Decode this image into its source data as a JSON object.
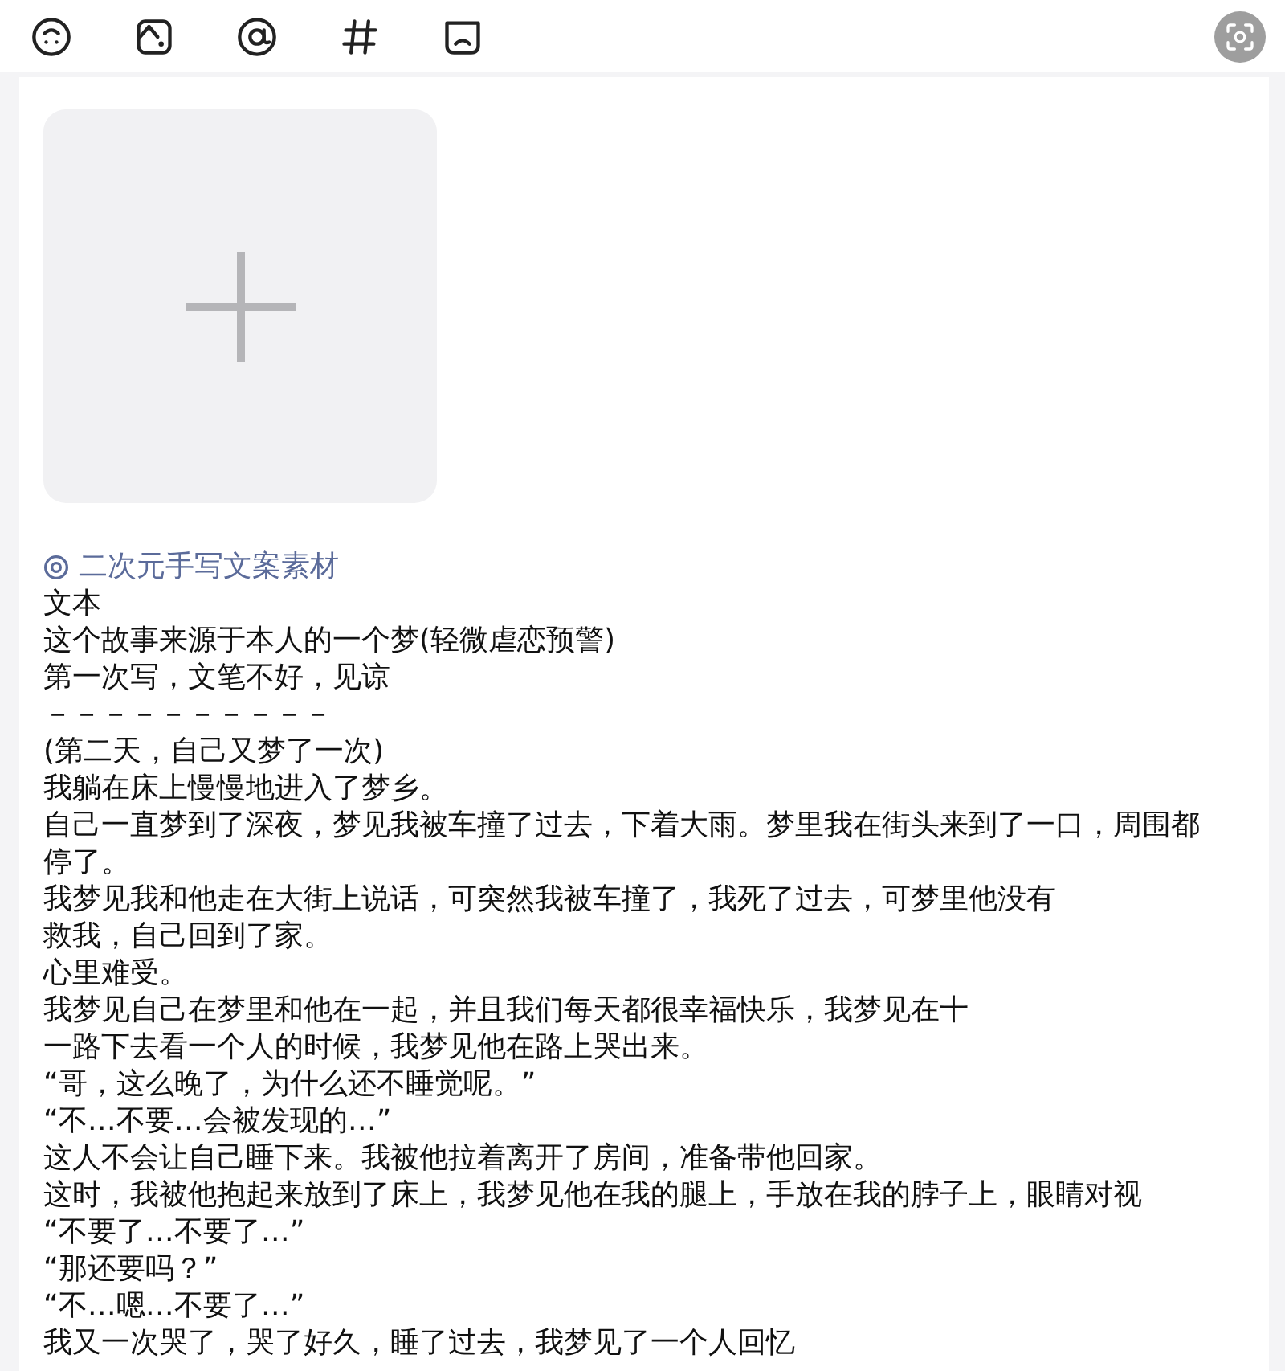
{
  "toolbar": {
    "tools": [
      {
        "kind": "emoji"
      },
      {
        "kind": "image"
      },
      {
        "kind": "mention"
      },
      {
        "kind": "topic"
      },
      {
        "kind": "box"
      }
    ]
  },
  "editor": {
    "image_slot": {
      "kind": "add"
    },
    "topic_link": "二次元手写文案素材",
    "lines": [
      "文本",
      "这个故事来源于本人的一个梦(轻微虐恋预警)",
      "第一次写，文笔不好，见谅",
      "－－－－－－－－－－",
      "(第二天，自己又梦了一次)",
      "我躺在床上慢慢地进入了梦乡。",
      "自己一直梦到了深夜，梦见我被车撞了过去，下着大雨。梦里我在街头来到了一口，周围都",
      "停了。",
      "我梦见我和他走在大街上说话，可突然我被车撞了，我死了过去，可梦里他没有",
      "救我，自己回到了家。",
      "心里难受。",
      "我梦见自己在梦里和他在一起，并且我们每天都很幸福快乐，我梦见在十",
      "一路下去看一个人的时候，我梦见他在路上哭出来。",
      "“哥，这么晚了，为什么还不睡觉呢。”",
      "“不…不要…会被发现的…”",
      "这人不会让自己睡下来。我被他拉着离开了房间，准备带他回家。",
      "这时，我被他抱起来放到了床上，我梦见他在我的腿上，手放在我的脖子上，眼睛对视",
      "“不要了…不要了…”",
      "“那还要吗？”",
      "“不…嗯…不要了…”",
      "我又一次哭了，哭了好久，睡了过去，我梦见了一个人回忆"
    ]
  }
}
